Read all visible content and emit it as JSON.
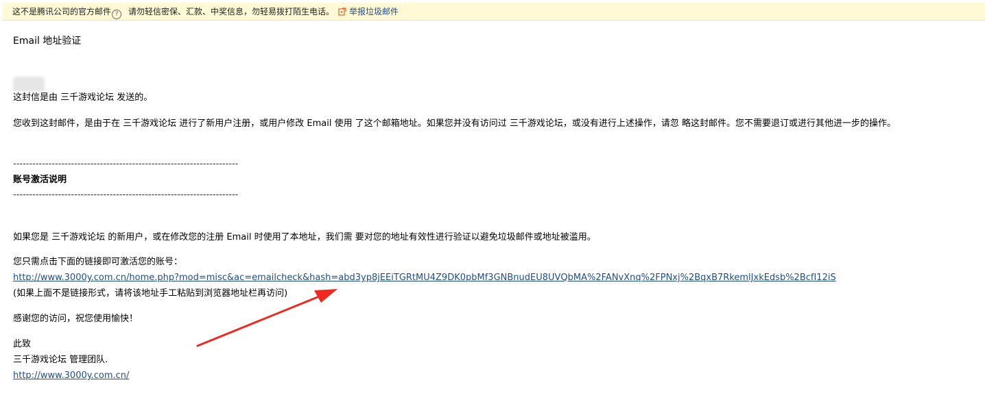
{
  "notice": {
    "not_official": "这不是腾讯公司的官方邮件",
    "help_symbol": "?",
    "warning": "请勿轻信密保、汇款、中奖信息，勿轻易拨打陌生电话。",
    "report_label": "举报垃圾邮件"
  },
  "email": {
    "heading": "Email 地址验证",
    "sender_line": "这封信是由 三千游戏论坛 发送的。",
    "reason": "您收到这封邮件，是由于在 三千游戏论坛 进行了新用户注册，或用户修改 Email 使用 了这个邮箱地址。如果您并没有访问过 三千游戏论坛，或没有进行上述操作，请忽 略这封邮件。您不需要退订或进行其他进一步的操作。",
    "divider": "----------------------------------------------------------------------",
    "section_title": "账号激活说明",
    "explain": "如果您是 三千游戏论坛 的新用户，或在修改您的注册 Email 时使用了本地址，我们需 要对您的地址有效性进行验证以避免垃圾邮件或地址被滥用。",
    "click_instruction": "您只需点击下面的链接即可激活您的账号：",
    "activation_link": "http://www.3000y.com.cn/home.php?mod=misc&ac=emailcheck&hash=abd3yp8jEEiTGRtMU4Z9DK0pbMf3GNBnudEU8UVQbMA%2FANvXnq%2FPNxj%2BqxB7RkemlJxkEdsb%2BcfI12iS",
    "paste_hint": "(如果上面不是链接形式，请将该地址手工粘贴到浏览器地址栏再访问)",
    "thanks": "感谢您的访问，祝您使用愉快！",
    "closing": "此致",
    "signature": "三千游戏论坛 管理团队.",
    "site_link": "http://www.3000y.com.cn/"
  },
  "colors": {
    "notice_bg": "#fff9d6",
    "link": "#1d4d8f",
    "arrow": "#f0281e"
  },
  "icons": {
    "help": "question-circle-icon",
    "report": "report-flag-icon"
  }
}
